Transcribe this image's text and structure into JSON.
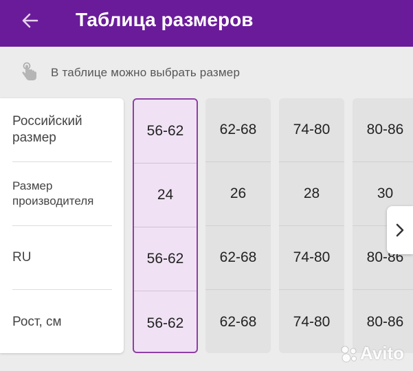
{
  "header": {
    "title": "Таблица размеров",
    "back_icon": "arrow-left-icon",
    "background": "#6a1b9a"
  },
  "hint": {
    "icon": "tap-hand-icon",
    "text": "В таблице можно выбрать размер"
  },
  "row_labels": [
    "Российский размер",
    "Размер производителя",
    "RU",
    "Рост, см"
  ],
  "columns": [
    {
      "selected": true,
      "cells": [
        "56-62",
        "24",
        "56-62",
        "56-62"
      ]
    },
    {
      "selected": false,
      "cells": [
        "62-68",
        "26",
        "62-68",
        "62-68"
      ]
    },
    {
      "selected": false,
      "cells": [
        "74-80",
        "28",
        "74-80",
        "74-80"
      ]
    },
    {
      "selected": false,
      "cells": [
        "80-86",
        "30",
        "80-86",
        "80-86"
      ]
    }
  ],
  "next_button_icon": "chevron-right-icon",
  "watermark": "Avito",
  "colors": {
    "accent": "#6a1b9a",
    "selected_bg": "#f0e2f4",
    "selected_border": "#8e3fa6",
    "column_bg": "#e2e2e2"
  }
}
